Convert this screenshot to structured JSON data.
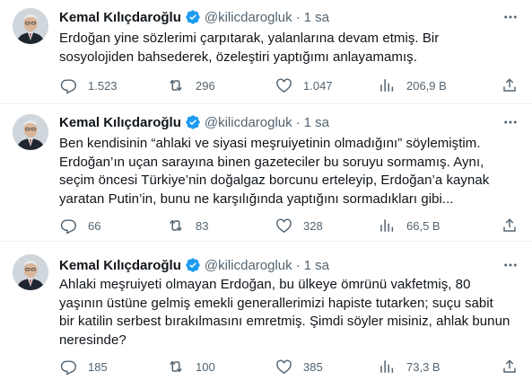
{
  "tweets": [
    {
      "author": {
        "name": "Kemal Kılıçdaroğlu",
        "handle": "@kilicdarogluk",
        "separator": "·",
        "time": "1 sa"
      },
      "text_lines": [
        "Erdoğan yine sözlerimi çarpıtarak, yalanlarına devam etmiş. Bir",
        "sosyolojiden bahsederek, özeleştiri yaptığımı anlayamamış."
      ],
      "stats": {
        "replies": "1.523",
        "retweets": "296",
        "likes": "1.047",
        "views": "206,9 B"
      }
    },
    {
      "author": {
        "name": "Kemal Kılıçdaroğlu",
        "handle": "@kilicdarogluk",
        "separator": "·",
        "time": "1 sa"
      },
      "text_lines": [
        "Ben kendisinin “ahlaki ve siyasi meşruiyetinin olmadığını” söylemiştim.",
        "Erdoğan’ın uçan sarayına binen gazeteciler bu soruyu sormamış. Aynı,",
        "seçim öncesi Türkiye’nin doğalgaz borcunu erteleyip, Erdoğan’a kaynak",
        "yaratan Putin’in, bunu ne karşılığında yaptığını sormadıkları gibi..."
      ],
      "stats": {
        "replies": "66",
        "retweets": "83",
        "likes": "328",
        "views": "66,5 B"
      }
    },
    {
      "author": {
        "name": "Kemal Kılıçdaroğlu",
        "handle": "@kilicdarogluk",
        "separator": "·",
        "time": "1 sa"
      },
      "text_lines": [
        "Ahlaki meşruiyeti olmayan Erdoğan, bu ülkeye ömrünü vakfetmiş, 80",
        "yaşının üstüne gelmiş emekli generallerimizi hapiste tutarken; suçu sabit",
        "bir katilin serbest bırakılmasını emretmiş. Şimdi söyler misiniz, ahlak bunun",
        "neresinde?"
      ],
      "stats": {
        "replies": "185",
        "retweets": "100",
        "likes": "385",
        "views": "73,3 B"
      }
    }
  ],
  "icons": {
    "verified": "verified-badge-icon",
    "more": "more-options-icon",
    "reply": "reply-icon",
    "retweet": "retweet-icon",
    "like": "like-icon",
    "views": "views-icon",
    "share": "share-icon"
  },
  "colors": {
    "text": "#0f1419",
    "secondary": "#536471",
    "verified": "#1d9bf0",
    "divider": "#eff3f4"
  }
}
